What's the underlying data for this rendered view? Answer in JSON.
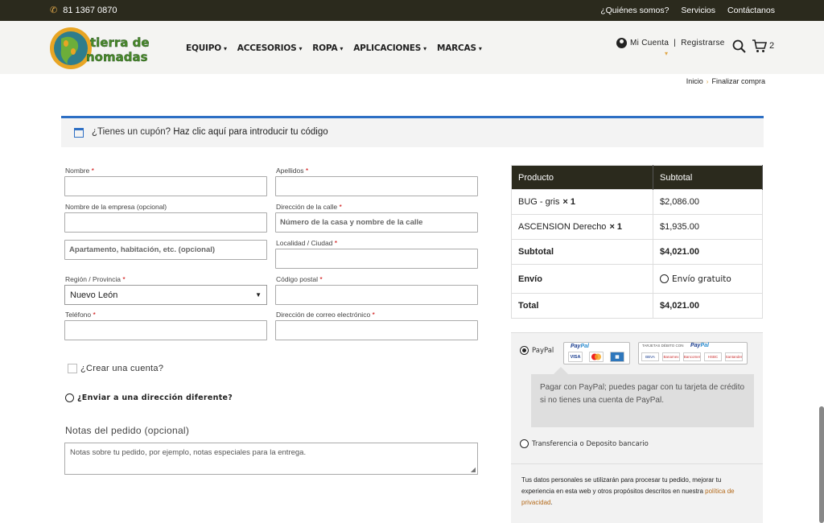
{
  "topbar": {
    "phone": "81 1367 0870",
    "links": [
      "¿Quiénes somos?",
      "Servicios",
      "Contáctanos"
    ]
  },
  "header": {
    "logo_text_line1": "tierra de",
    "logo_text_line2": "nomadas",
    "nav": [
      "EQUIPO",
      "ACCESORIOS",
      "ROPA",
      "APLICACIONES",
      "MARCAS"
    ],
    "account": "Mi Cuenta",
    "register": "Registrarse",
    "account_sep": "|",
    "cart_count": "2"
  },
  "breadcrumb": {
    "home": "Inicio",
    "current": "Finalizar compra"
  },
  "coupon": {
    "question": "¿Tienes un cupón?",
    "link": "Haz clic aquí para introducir tu código"
  },
  "billing": {
    "nombre_label": "Nombre",
    "apellidos_label": "Apellidos",
    "empresa_label": "Nombre de la empresa (opcional)",
    "calle_label": "Dirección de la calle",
    "calle_placeholder": "Número de la casa y nombre de la calle",
    "apartamento_placeholder": "Apartamento, habitación, etc. (opcional)",
    "localidad_label": "Localidad / Ciudad",
    "region_label": "Región / Provincia",
    "region_value": "Nuevo León",
    "postal_label": "Código postal",
    "telefono_label": "Teléfono",
    "email_label": "Dirección de correo electrónico",
    "required_mark": "*",
    "create_account": "¿Crear una cuenta?",
    "ship_different": "¿Enviar a una dirección diferente?",
    "notes_label": "Notas del pedido (opcional)",
    "notes_placeholder": "Notas sobre tu pedido, por ejemplo, notas especiales para la entrega."
  },
  "order": {
    "col_product": "Producto",
    "col_subtotal": "Subtotal",
    "items": [
      {
        "name": "BUG - gris",
        "qty": "× 1",
        "price": "$2,086.00"
      },
      {
        "name": "ASCENSION Derecho",
        "qty": "× 1",
        "price": "$1,935.00"
      }
    ],
    "subtotal_label": "Subtotal",
    "subtotal_value": "$4,021.00",
    "shipping_label": "Envío",
    "shipping_value": "Envío gratuito",
    "total_label": "Total",
    "total_value": "$4,021.00"
  },
  "payment": {
    "paypal_label": "PayPal",
    "paypal_brand_a": "Pay",
    "paypal_brand_b": "Pal",
    "debit_caption": "TARJETAS DÉBITO CON",
    "cards": [
      "VISA",
      "MC",
      "AMEX"
    ],
    "banks": [
      "BBVA",
      "Banamex",
      "Bancomer",
      "HSBC",
      "Santander"
    ],
    "paypal_desc": "Pagar con PayPal; puedes pagar con tu tarjeta de crédito si no tienes una cuenta de PayPal.",
    "transfer_label": "Transferencia o Deposito bancario",
    "privacy_text": "Tus datos personales se utilizarán para procesar tu pedido, mejorar tu experiencia en esta web y otros propósitos descritos en nuestra",
    "privacy_link": "política de privacidad",
    "privacy_end": "."
  },
  "colors": {
    "topbar": "#2b2a1d",
    "accent_blue": "#2d6fc4",
    "accent_orange": "#e0a84a",
    "table_header": "#2b2a1d"
  }
}
